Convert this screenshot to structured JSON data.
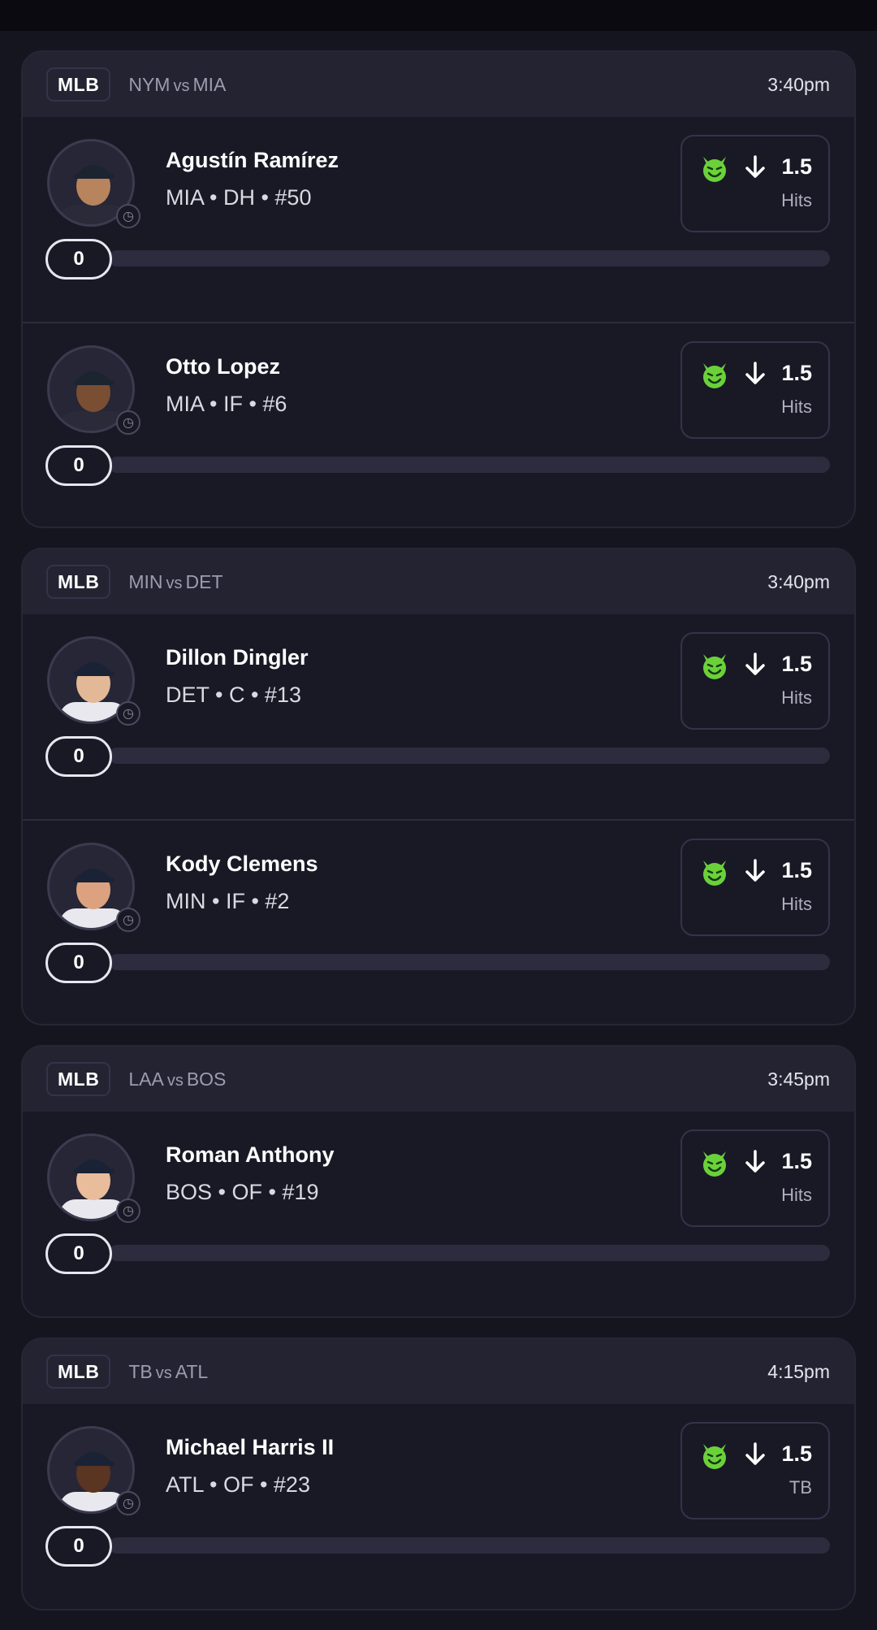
{
  "theme": {
    "background": "#15151f",
    "card": "#191926",
    "accent_green": "#6bd13a"
  },
  "games": [
    {
      "league": "MLB",
      "away": "NYM",
      "vs": "vs",
      "home": "MIA",
      "time": "3:40pm",
      "players": [
        {
          "name": "Agustín Ramírez",
          "meta": "MIA • DH • #50",
          "line": "1.5",
          "stat": "Hits",
          "direction": "under",
          "count": "0",
          "progress": 0,
          "jersey": "#2a2a38",
          "cap": "#1c2430",
          "skin": "#b8845e"
        },
        {
          "name": "Otto Lopez",
          "meta": "MIA • IF • #6",
          "line": "1.5",
          "stat": "Hits",
          "direction": "under",
          "count": "0",
          "progress": 0,
          "jersey": "#2a2a38",
          "cap": "#1c2430",
          "skin": "#7a4e32"
        }
      ]
    },
    {
      "league": "MLB",
      "away": "MIN",
      "vs": "vs",
      "home": "DET",
      "time": "3:40pm",
      "players": [
        {
          "name": "Dillon Dingler",
          "meta": "DET • C • #13",
          "line": "1.5",
          "stat": "Hits",
          "direction": "under",
          "count": "0",
          "progress": 0,
          "jersey": "#e8e8ee",
          "cap": "#1a2236",
          "skin": "#e3b896"
        },
        {
          "name": "Kody Clemens",
          "meta": "MIN • IF • #2",
          "line": "1.5",
          "stat": "Hits",
          "direction": "under",
          "count": "0",
          "progress": 0,
          "jersey": "#e8e8ee",
          "cap": "#1a2236",
          "skin": "#dca27f"
        }
      ]
    },
    {
      "league": "MLB",
      "away": "LAA",
      "vs": "vs",
      "home": "BOS",
      "time": "3:45pm",
      "players": [
        {
          "name": "Roman Anthony",
          "meta": "BOS • OF • #19",
          "line": "1.5",
          "stat": "Hits",
          "direction": "under",
          "count": "0",
          "progress": 0,
          "jersey": "#e8e8ee",
          "cap": "#1a2236",
          "skin": "#e9bd9c"
        }
      ]
    },
    {
      "league": "MLB",
      "away": "TB",
      "vs": "vs",
      "home": "ATL",
      "time": "4:15pm",
      "players": [
        {
          "name": "Michael Harris II",
          "meta": "ATL • OF • #23",
          "line": "1.5",
          "stat": "TB",
          "direction": "under",
          "count": "0",
          "progress": 0,
          "jersey": "#e8e8ee",
          "cap": "#1a2236",
          "skin": "#5a3522"
        }
      ]
    }
  ]
}
